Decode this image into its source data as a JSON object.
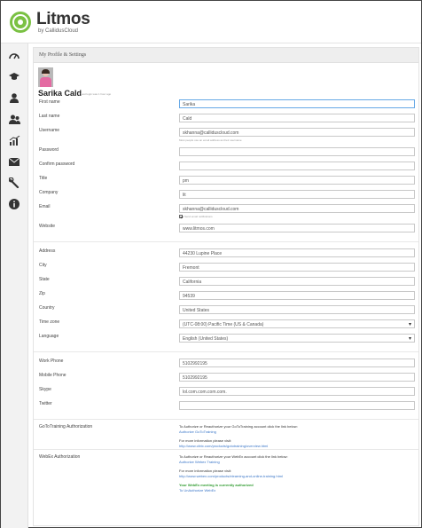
{
  "app": {
    "logo_text": "Litmos",
    "logo_subtitle": "by CallidusCloud"
  },
  "nav": [
    {
      "icon": "dashboard-icon"
    },
    {
      "icon": "graduation-cap-icon"
    },
    {
      "icon": "user-icon"
    },
    {
      "icon": "users-icon"
    },
    {
      "icon": "bar-chart-icon"
    },
    {
      "icon": "envelope-icon"
    },
    {
      "icon": "wrench-icon"
    },
    {
      "icon": "info-icon"
    }
  ],
  "page": {
    "title": "My Profile & Settings"
  },
  "profile": {
    "name": "Sarika Cald",
    "last_login": "Last login was 1 hour ago"
  },
  "fields": {
    "first_name": {
      "label": "First name",
      "value": "Sarika"
    },
    "last_name": {
      "label": "Last name",
      "value": "Cald"
    },
    "username": {
      "label": "Username",
      "value": "skhanna@calliduscloud.com",
      "hint": "Most people use an email address as their username"
    },
    "password": {
      "label": "Password",
      "value": ""
    },
    "confirm_password": {
      "label": "Confirm password",
      "value": ""
    },
    "title": {
      "label": "Title",
      "value": "pm"
    },
    "company": {
      "label": "Company",
      "value": "lit"
    },
    "email": {
      "label": "Email",
      "value": "skhanna@calliduscloud.com",
      "checkbox_label": "Send email notifications"
    },
    "website": {
      "label": "Website",
      "value": "www.litmos.com"
    },
    "address": {
      "label": "Address",
      "value": "44230 Lupine Place"
    },
    "city": {
      "label": "City",
      "value": "Fremont"
    },
    "state": {
      "label": "State",
      "value": "California"
    },
    "zip": {
      "label": "Zip",
      "value": "94539"
    },
    "country": {
      "label": "Country",
      "value": "United States"
    },
    "time_zone": {
      "label": "Time zone",
      "value": "(UTC-08:00) Pacific Time (US & Canada)"
    },
    "language": {
      "label": "Language",
      "value": "English (United States)"
    },
    "work_phone": {
      "label": "Work Phone",
      "value": "5102992195"
    },
    "mobile_phone": {
      "label": "Mobile Phone",
      "value": "5102992195"
    },
    "skype": {
      "label": "Skype",
      "value": "lol.com.com.com.com."
    },
    "twitter": {
      "label": "Twitter",
      "value": ""
    }
  },
  "gototraining": {
    "label": "GoToTraining Authorization",
    "intro": "To Authorize or Reauthorize your GoToTraining account click the link below:",
    "link": "Authorize GoToTraining",
    "more_info": "For more information please visit:",
    "url": "http://www.citrix.com/products/gototraining/overview.html"
  },
  "webex": {
    "label": "WebEx Authorization",
    "intro": "To Authorize or Reauthorize your WebEx account click the link below:",
    "link": "Authorize Webex Training",
    "more_info": "For more information please visit:",
    "url": "http://www.webex.com/products/elearning-and-online-training.html",
    "status": "Your WebEx meeting is currently authorized",
    "unauth_link": "To UnAuthorize WebEx"
  },
  "colors": {
    "brand_green": "#7ac143",
    "link_blue": "#3a76c8",
    "success_green": "#2f9b2f"
  }
}
